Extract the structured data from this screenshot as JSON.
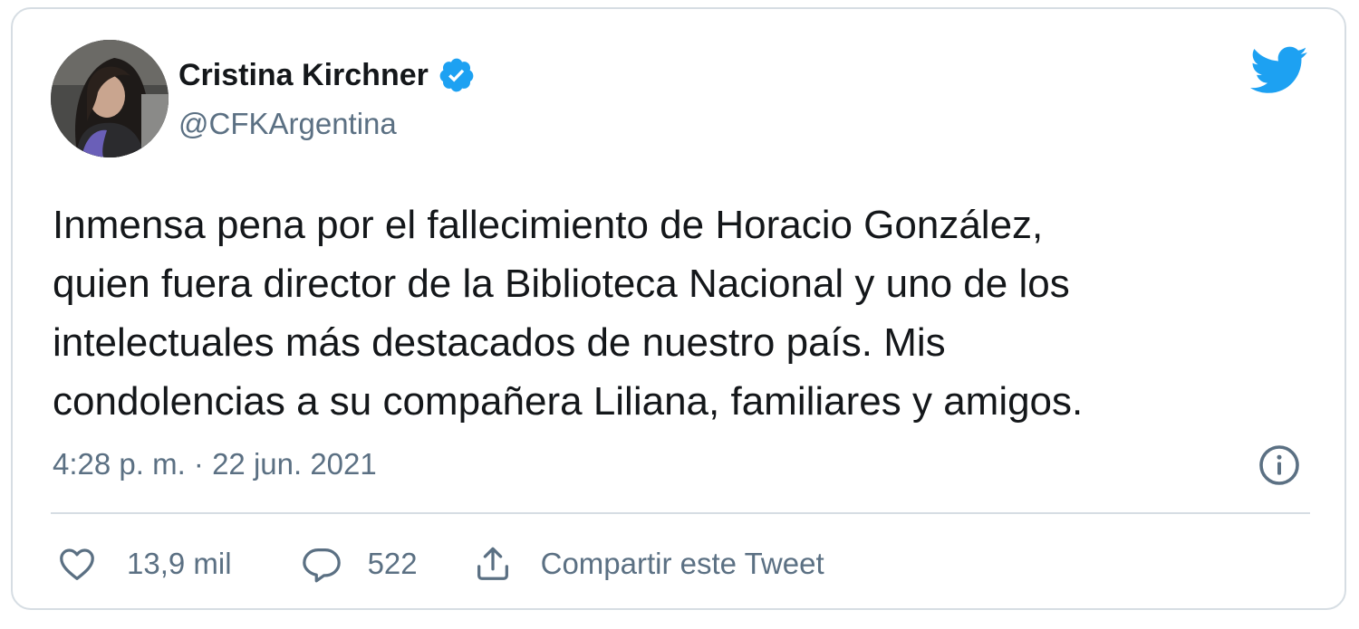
{
  "author": {
    "name": "Cristina Kirchner",
    "handle": "@CFKArgentina",
    "verified_icon": "verified-badge-icon",
    "avatar_icon": "profile-photo"
  },
  "brand": {
    "icon": "twitter-bird-icon",
    "color": "#1da1f2"
  },
  "tweet": {
    "lines": [
      "Inmensa pena por el fallecimiento de Horacio González,",
      "quien fuera director de la Biblioteca Nacional y uno de los",
      "intelectuales más destacados de nuestro país. Mis",
      "condolencias a su compañera Liliana, familiares y amigos."
    ],
    "timestamp": "4:28 p. m. · 22 jun. 2021"
  },
  "actions": {
    "likes": "13,9 mil",
    "replies": "522",
    "share_label": "Compartir este Tweet"
  },
  "colors": {
    "text": "#14171a",
    "secondary": "#5b7083",
    "border": "#d6dde3"
  }
}
